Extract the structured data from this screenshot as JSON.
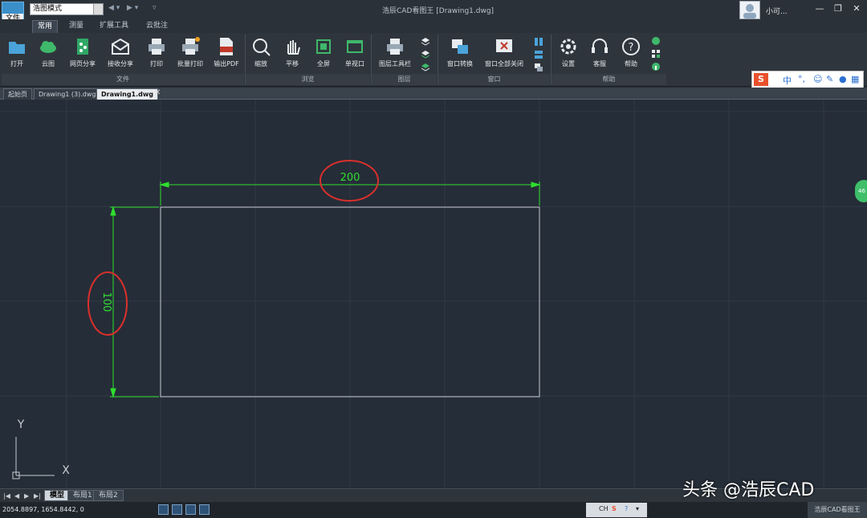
{
  "app": {
    "logo_label": "文件",
    "mode_select": "浩图模式",
    "title": "浩辰CAD看图王",
    "file_title": "[Drawing1.dwg]",
    "user_name": "小可..."
  },
  "ribbon_tabs": [
    "常用",
    "测量",
    "扩展工具",
    "云批注"
  ],
  "ribbon": {
    "buttons": {
      "open": "打开",
      "cloud": "云图",
      "web_share": "网页分享",
      "receive_share": "接收分享",
      "print": "打印",
      "batch_print": "批量打印",
      "export_pdf": "输出PDF",
      "zoom": "缩放",
      "pan": "平移",
      "fullscreen": "全屏",
      "single_window": "单视口",
      "layer_toolbar": "图层工具栏",
      "window_switch": "窗口转换",
      "close_all_windows": "窗口全部关闭",
      "settings": "设置",
      "customer_service": "客服",
      "help": "帮助"
    },
    "groups": {
      "file": "文件",
      "browse": "浏览",
      "layer": "图层",
      "window": "窗口",
      "help": "帮助"
    }
  },
  "ime": {
    "logo": "S",
    "lang": "中",
    "punct": "°,"
  },
  "doc_tabs": [
    "起始页",
    "Drawing1 (3).dwg",
    "Drawing1.dwg"
  ],
  "doc_tab_close": "✕",
  "drawing": {
    "dim_horizontal": "200",
    "dim_vertical": "100",
    "axis_y": "Y",
    "axis_x": "X",
    "colors": {
      "dimension": "#2ee02e",
      "geometry": "#c8ccd0",
      "annotation": "#d9302c"
    }
  },
  "side_badge": "46",
  "layout_tabs": [
    "模型",
    "布局1",
    "布局2"
  ],
  "status": {
    "coords": "2054.8897, 1654.8442, 0",
    "tray_lang": "CH",
    "app_name": "浩辰CAD看图王"
  },
  "watermark": "头条 @浩辰CAD"
}
